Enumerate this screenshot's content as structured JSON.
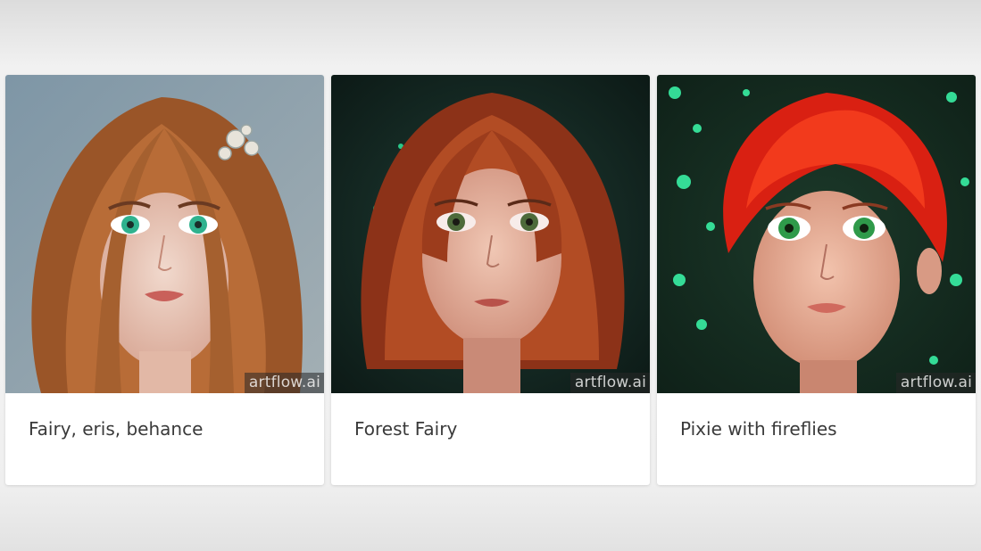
{
  "gallery": {
    "cards": [
      {
        "title": "Fairy, eris, behance",
        "watermark": "artflow.ai"
      },
      {
        "title": "Forest Fairy",
        "watermark": "artflow.ai"
      },
      {
        "title": "Pixie with fireflies",
        "watermark": "artflow.ai"
      }
    ]
  }
}
